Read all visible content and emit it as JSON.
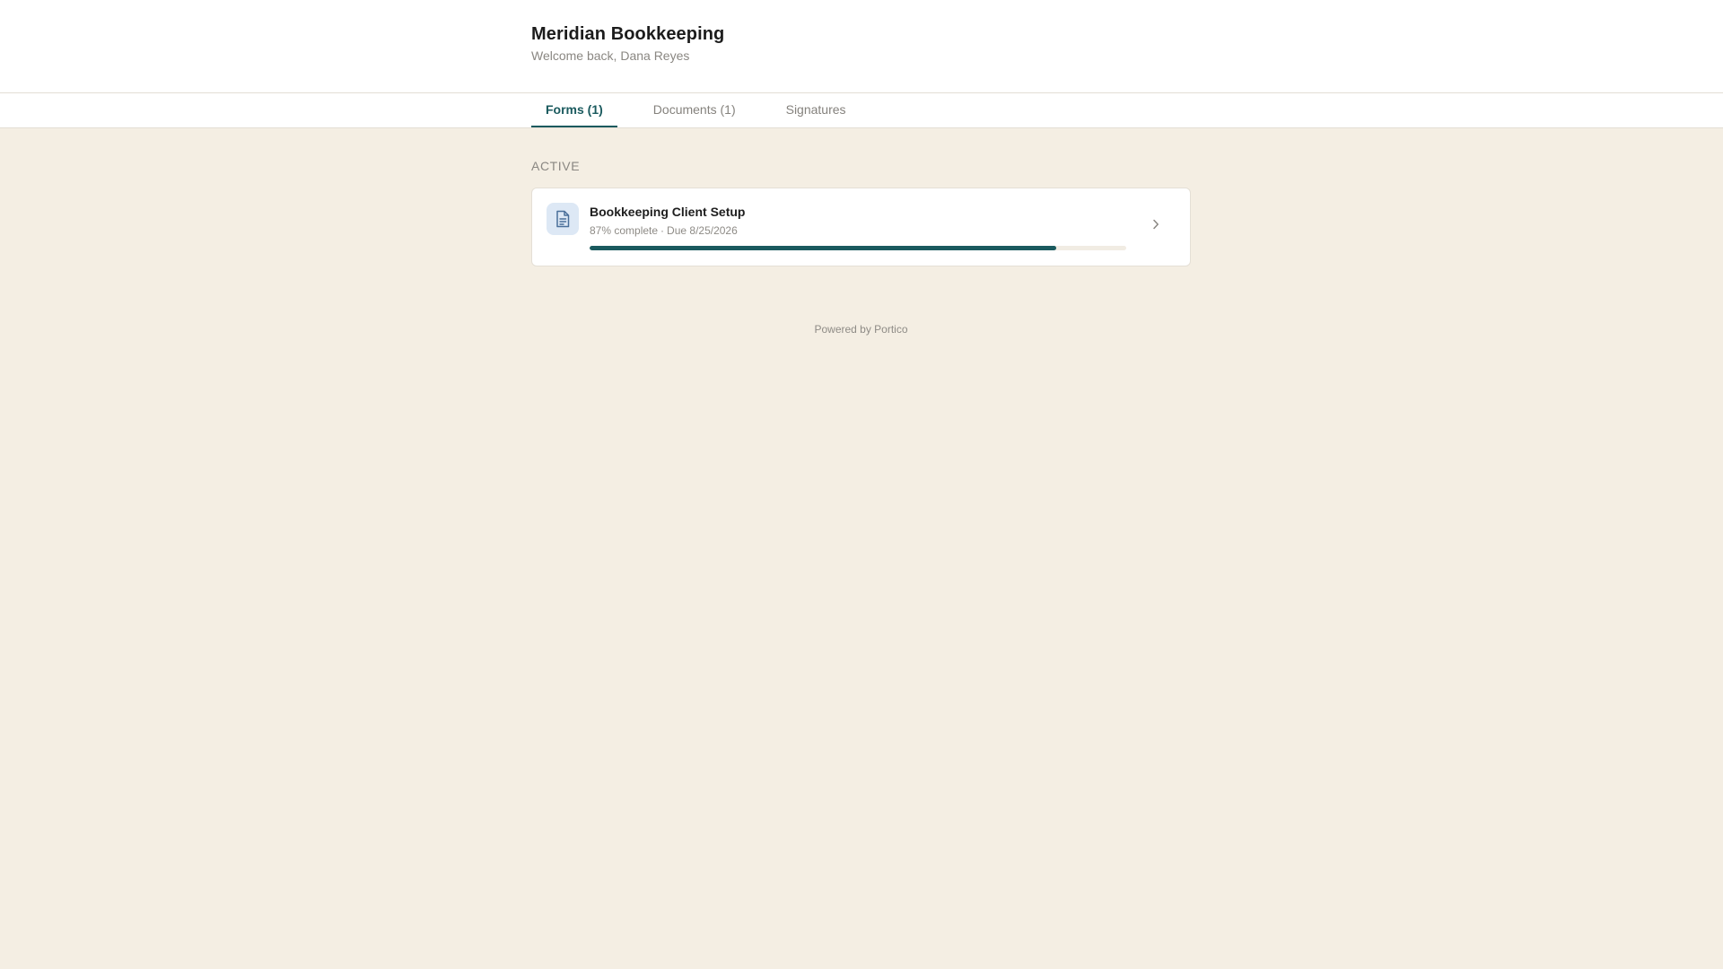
{
  "header": {
    "org_name": "Meridian Bookkeeping",
    "welcome": "Welcome back, Dana Reyes"
  },
  "tabs": [
    {
      "label": "Forms (1)",
      "active": true
    },
    {
      "label": "Documents (1)",
      "active": false
    },
    {
      "label": "Signatures",
      "active": false
    }
  ],
  "main": {
    "section_label": "ACTIVE",
    "forms": [
      {
        "title": "Bookkeeping Client Setup",
        "progress_text": "87% complete",
        "separator": "·",
        "due": "Due 8/25/2026",
        "progress": 0.87,
        "icon": "document-icon"
      }
    ]
  },
  "footer": {
    "powered_by": "Powered by Portico"
  },
  "colors": {
    "accent": "#1a5a5e",
    "background": "#f4eee3",
    "icon_bg": "#dde8f5"
  }
}
